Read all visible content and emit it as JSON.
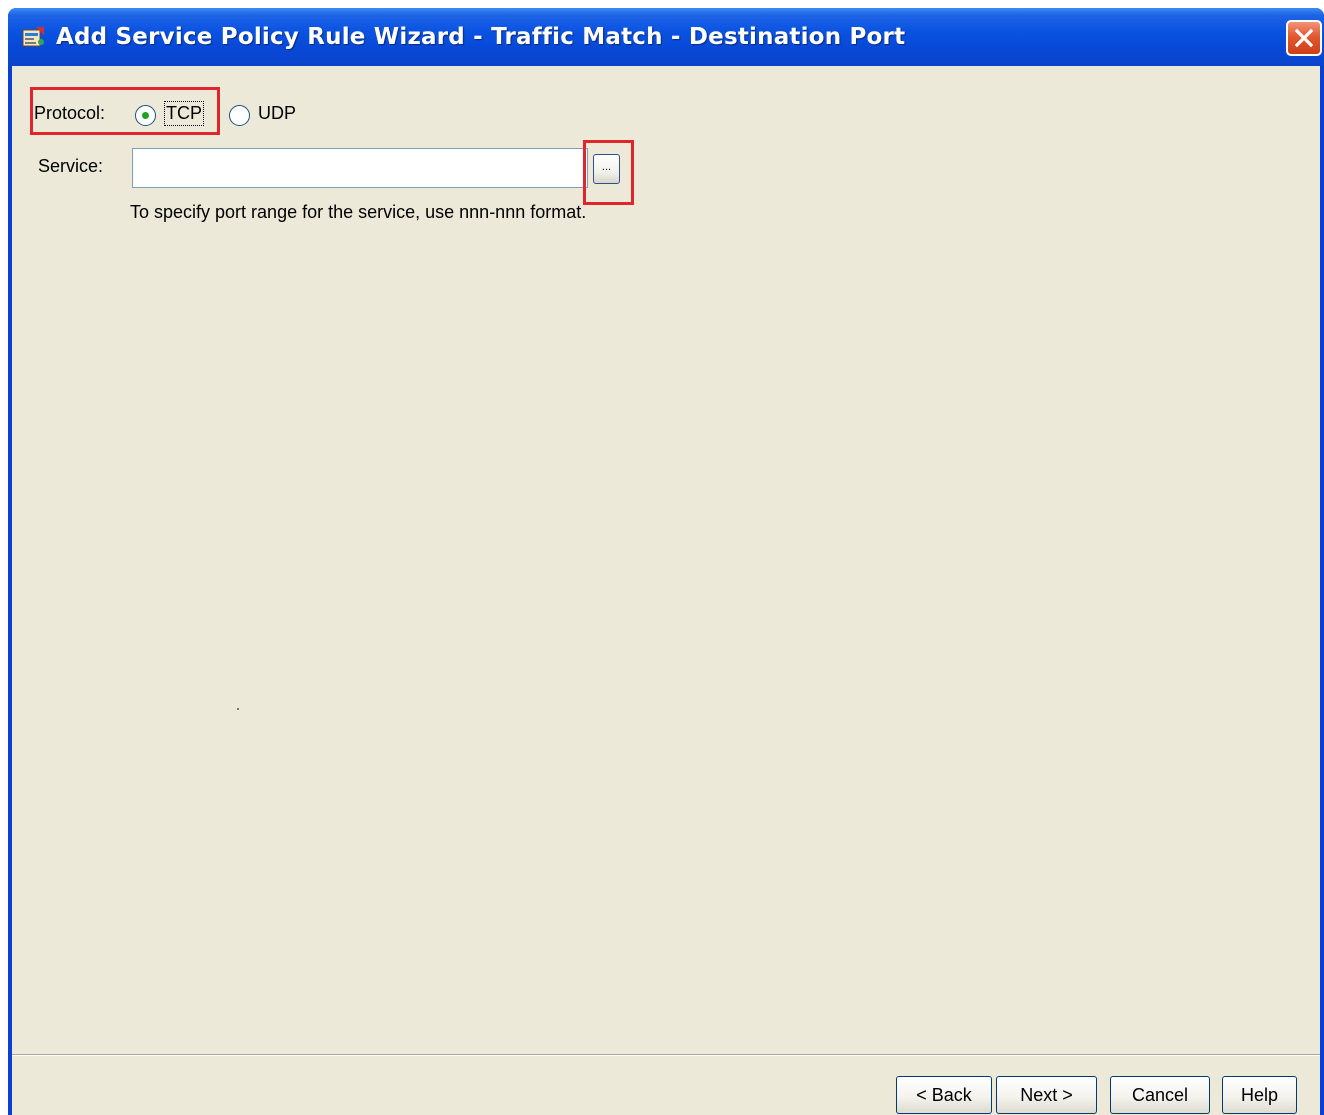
{
  "window": {
    "title": "Add Service Policy Rule Wizard - Traffic Match - Destination Port",
    "title_icon": "wizard-app-icon",
    "close_icon": "close-icon"
  },
  "protocol": {
    "label": "Protocol:",
    "options": [
      {
        "label": "TCP",
        "checked": true
      },
      {
        "label": "UDP",
        "checked": false
      }
    ]
  },
  "service": {
    "label": "Service:",
    "value": "",
    "browse_label": "...",
    "hint": "To specify port range for the service, use nnn-nnn format."
  },
  "buttons": {
    "back": "< Back",
    "next": "Next >",
    "cancel": "Cancel",
    "help": "Help"
  },
  "colors": {
    "titlebar": "#0a53e2",
    "dialog_background": "#ece9d8",
    "highlight_box": "#e0262c",
    "close_button": "#e2582f"
  }
}
